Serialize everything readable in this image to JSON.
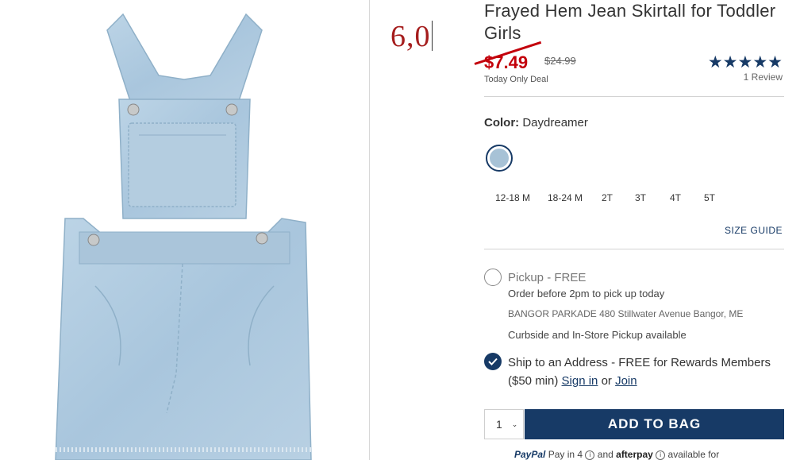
{
  "annotation": {
    "text": "6,0"
  },
  "product": {
    "title": "Frayed Hem Jean Skirtall for Toddler Girls",
    "sale_price": "$7.49",
    "original_price": "$24.99",
    "deal_label": "Today Only Deal",
    "stars": "★★★★★",
    "rating": 5,
    "reviews": "1 Review"
  },
  "color": {
    "label": "Color:",
    "value": "Daydreamer",
    "swatch_color": "#a7c2d6"
  },
  "sizes": [
    "12-18 M",
    "18-24 M",
    "2T",
    "3T",
    "4T",
    "5T"
  ],
  "size_guide": "SIZE GUIDE",
  "fulfillment": {
    "pickup_label": "Pickup - FREE",
    "pickup_note": "Order before 2pm to pick up today",
    "store": "BANGOR PARKADE 480 Stillwater Avenue  Bangor, ME",
    "curbside": "Curbside and In-Store Pickup available",
    "ship_text": "Ship to an Address - FREE for Rewards Members ($50 min)",
    "sign_in": "Sign in",
    "or": "or",
    "join": "Join"
  },
  "cart": {
    "quantity": "1",
    "add_to_bag": "ADD TO BAG"
  },
  "payment": {
    "paypal": "PayPal",
    "paypal_text": "Pay in 4",
    "and": "and",
    "afterpay": "afterpay",
    "available": "available for"
  },
  "colors": {
    "brand_navy": "#173a66",
    "sale_red": "#c3000b"
  }
}
